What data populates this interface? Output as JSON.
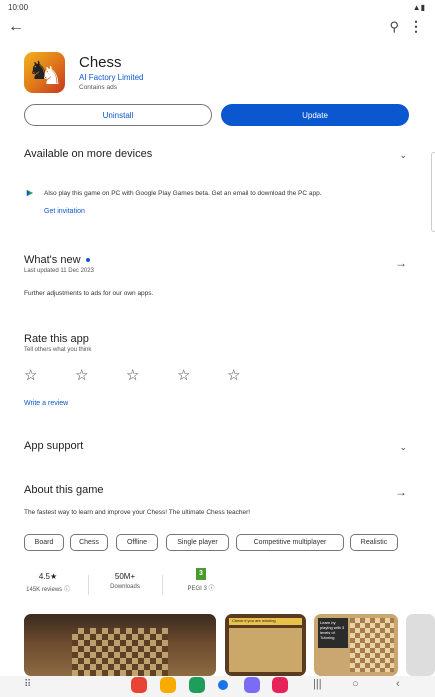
{
  "status": {
    "time": "10:00",
    "signal": "▲▮"
  },
  "topbar": {
    "back": "←",
    "search": "⚲",
    "more": "⋮"
  },
  "app": {
    "title": "Chess",
    "developer": "AI Factory Limited",
    "ads": "Contains ads"
  },
  "buttons": {
    "uninstall": "Uninstall",
    "update": "Update"
  },
  "devices": {
    "title": "Available on more devices",
    "text": "Also play this game on PC with Google Play Games beta. Get an email to download the PC app.",
    "link": "Get invitation"
  },
  "whats_new": {
    "title": "What's new",
    "updated": "Last updated 11 Dec 2023",
    "text": "Further adjustments to ads for our own apps."
  },
  "rate": {
    "title": "Rate this app",
    "subtitle": "Tell others what you think",
    "link": "Write a review",
    "stars": 5
  },
  "support": {
    "title": "App support"
  },
  "about": {
    "title": "About this game",
    "text": "The fastest way to learn and improve your Chess! The ultimate Chess teacher!",
    "chips": [
      "Board",
      "Chess",
      "Offline",
      "Single player",
      "Competitive multiplayer",
      "Realistic"
    ]
  },
  "stats": {
    "rating": "4.5★",
    "reviews": "145K reviews ⓘ",
    "downloads": "50M+",
    "downloads_label": "Downloads",
    "pegi_badge": "3",
    "pegi": "PEGI 3 ⓘ"
  },
  "screenshots": {
    "caption2": "Check if you are winning",
    "caption3": "Learn by playing with 3 levels of Tutoring"
  },
  "icons": {
    "chevron": "chevron-down-icon",
    "arrow": "arrow-right-icon",
    "star": "star-outline-icon"
  },
  "colors": {
    "accent": "#0b57d0"
  }
}
